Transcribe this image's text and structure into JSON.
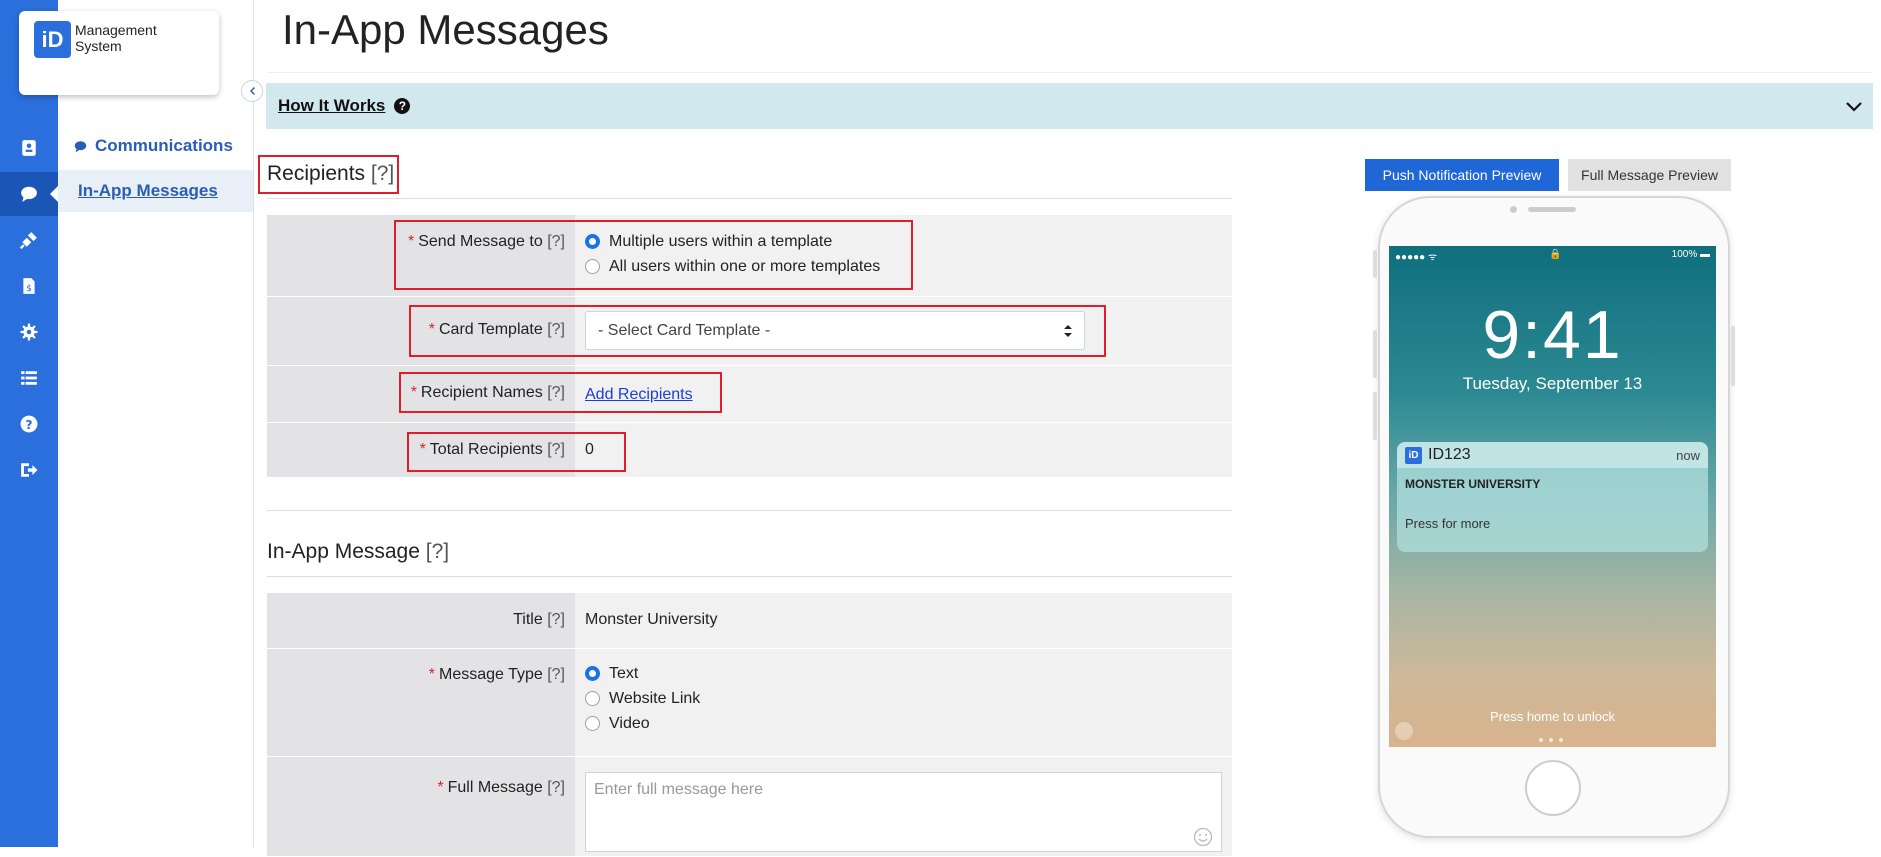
{
  "app": {
    "logo_mark": "iD",
    "logo_text": "Management System"
  },
  "sidebar_icons": [
    "id-card-icon",
    "chat-icon",
    "plug-icon",
    "document-dollar-icon",
    "gear-icon",
    "list-icon",
    "help-icon",
    "logout-icon"
  ],
  "subnav": {
    "section_label": "Communications",
    "active_item": "In-App Messages"
  },
  "page": {
    "title": "In-App Messages"
  },
  "how_it_works": {
    "label": "How It Works",
    "help_glyph": "?"
  },
  "recipients_section": {
    "title": "Recipients",
    "help": "[?]",
    "send_message_to": {
      "label": "Send Message to",
      "help": "[?]",
      "options": [
        "Multiple users within a template",
        "All users within one or more templates"
      ],
      "selected": "Multiple users within a template"
    },
    "card_template": {
      "label": "Card Template",
      "help": "[?]",
      "value": "- Select Card Template -"
    },
    "recipient_names": {
      "label": "Recipient Names",
      "help": "[?]",
      "link": "Add Recipients"
    },
    "total_recipients": {
      "label": "Total Recipients",
      "help": "[?]",
      "value": "0"
    }
  },
  "message_section": {
    "title": "In-App Message",
    "help": "[?]",
    "title_field": {
      "label": "Title",
      "help": "[?]",
      "value": "Monster University"
    },
    "message_type": {
      "label": "Message Type",
      "help": "[?]",
      "options": [
        "Text",
        "Website Link",
        "Video"
      ],
      "selected": "Text"
    },
    "full_message": {
      "label": "Full Message",
      "help": "[?]",
      "placeholder": "Enter full message here"
    }
  },
  "preview": {
    "push_button": "Push Notification Preview",
    "full_button": "Full Message Preview",
    "status_left": "●●●●● ᯤ",
    "status_lock": "🔒",
    "status_battery": "100% ▬",
    "time": "9:41",
    "date": "Tuesday, September 13",
    "notification": {
      "app_mark": "iD",
      "app_name": "ID123",
      "time": "now",
      "title": "MONSTER UNIVERSITY",
      "body": "Press for more"
    },
    "unlock_text": "Press home to unlock"
  },
  "colors": {
    "accent": "#2a6fdb",
    "required": "#d9252c",
    "highlight_box": "#e01e2b"
  }
}
